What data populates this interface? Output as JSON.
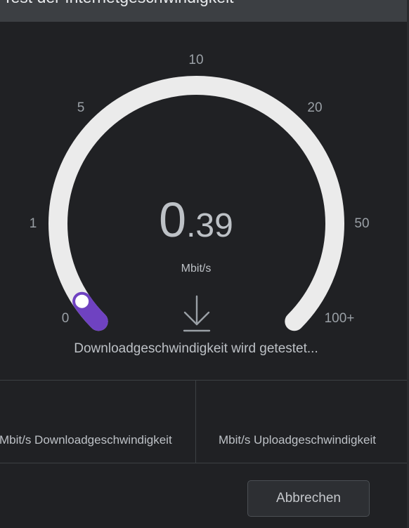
{
  "dialog": {
    "title": "Test der Internetgeschwindigkeit"
  },
  "gauge": {
    "ticks": [
      "0",
      "1",
      "5",
      "10",
      "20",
      "50",
      "100+"
    ],
    "speed_integer": "0",
    "speed_fraction": ".39",
    "unit": "Mbit/s",
    "progress": 0.04,
    "track_color": "#ebebeb",
    "progress_color": "#6f42c1",
    "direction_icon": "download-arrow-icon"
  },
  "status": {
    "text": "Downloadgeschwindigkeit wird getestet..."
  },
  "results": {
    "download_label": "Mbit/s Downloadgeschwindigkeit",
    "upload_label": "Mbit/s Uploadgeschwindigkeit"
  },
  "actions": {
    "cancel_label": "Abbrechen"
  }
}
